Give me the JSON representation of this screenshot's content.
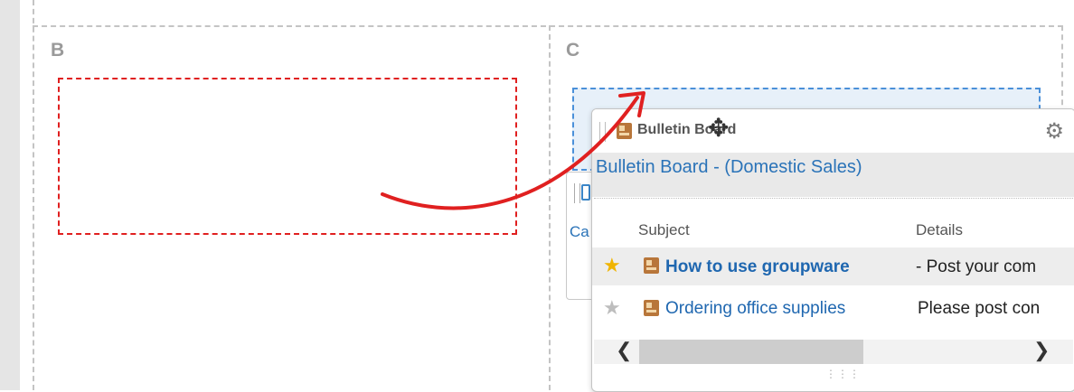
{
  "columns": {
    "b_label": "B",
    "c_label": "C"
  },
  "underlying_widget": {
    "partial_text": "Ca"
  },
  "widget": {
    "title": "Bulletin Board",
    "subtitle": "Bulletin Board - (Domestic Sales)",
    "headers": {
      "subject": "Subject",
      "details": "Details"
    },
    "rows": [
      {
        "subject": "How to use groupware",
        "details": "- Post your com",
        "starred": true,
        "bold": true
      },
      {
        "subject": "Ordering office supplies",
        "details": "Please post con",
        "starred": false,
        "bold": false
      }
    ],
    "icons": {
      "settings": "gear-icon",
      "move_cursor": "move-cursor-icon",
      "star_on": "star-filled-icon",
      "star_off": "star-empty-icon"
    }
  },
  "colors": {
    "accent_link": "#1f67b0",
    "drop_target_red": "#e02020",
    "drop_target_blue": "#4a90d9",
    "star_on": "#f0b400",
    "star_off": "#bdbdbd",
    "arrow": "#e02020"
  }
}
